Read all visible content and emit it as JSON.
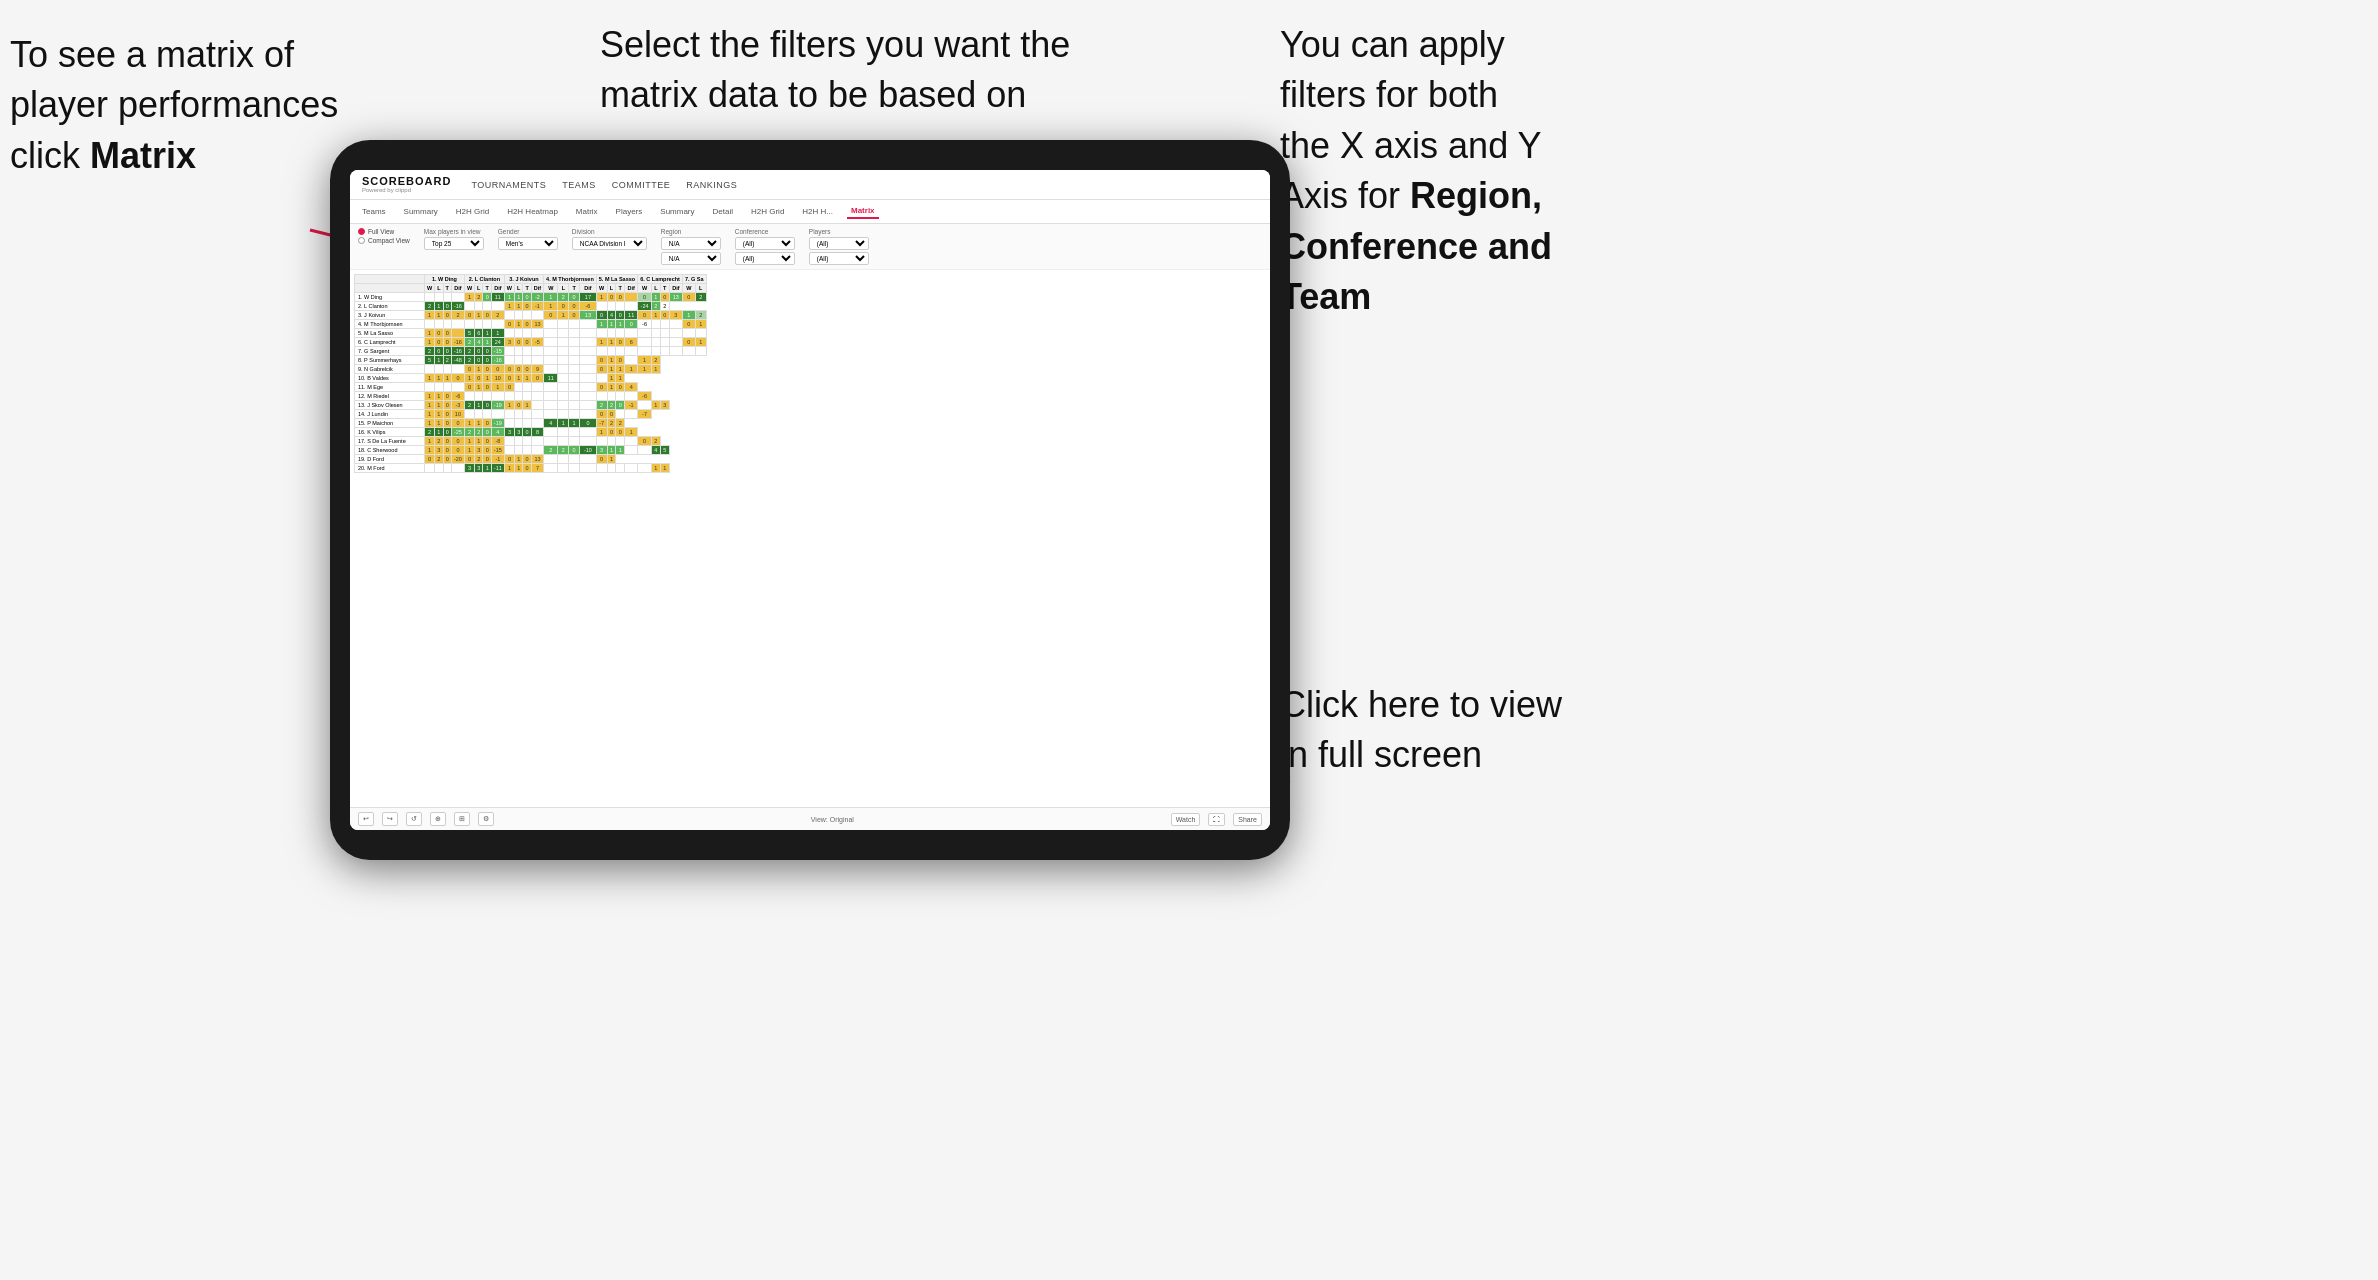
{
  "annotations": {
    "top_left": {
      "line1": "To see a matrix of",
      "line2": "player performances",
      "line3_prefix": "click ",
      "line3_bold": "Matrix"
    },
    "top_center": {
      "text": "Select the filters you want the matrix data to be based on"
    },
    "top_right": {
      "line1": "You  can apply",
      "line2": "filters for both",
      "line3": "the X axis and Y",
      "line4_prefix": "Axis for ",
      "line4_bold": "Region,",
      "line5_bold": "Conference and",
      "line6_bold": "Team"
    },
    "bottom_right": {
      "line1": "Click here to view",
      "line2": "in full screen"
    }
  },
  "app": {
    "brand": "SCOREBOARD",
    "powered_by": "Powered by clippd",
    "nav_items": [
      "TOURNAMENTS",
      "TEAMS",
      "COMMITTEE",
      "RANKINGS"
    ],
    "sub_nav_items": [
      "Teams",
      "Summary",
      "H2H Grid",
      "H2H Heatmap",
      "Matrix",
      "Players",
      "Summary",
      "Detail",
      "H2H Grid",
      "H2H H...",
      "Matrix"
    ],
    "active_tab": "Matrix"
  },
  "filters": {
    "view_full": "Full View",
    "view_compact": "Compact View",
    "max_players_label": "Max players in view",
    "max_players_value": "Top 25",
    "gender_label": "Gender",
    "gender_value": "Men's",
    "division_label": "Division",
    "division_value": "NCAA Division I",
    "region_label": "Region",
    "region_value": "N/A",
    "region_value2": "N/A",
    "conference_label": "Conference",
    "conference_value": "(All)",
    "conference_value2": "(All)",
    "players_label": "Players",
    "players_value": "(All)",
    "players_value2": "(All)"
  },
  "matrix": {
    "col_headers": [
      "1. W Ding",
      "2. L Clanton",
      "3. J Koivun",
      "4. M Thorbjornsen",
      "5. M La Sasso",
      "6. C Lamprecht",
      "7. G Sa"
    ],
    "sub_headers": [
      "W",
      "L",
      "T",
      "Dif"
    ],
    "rows": [
      {
        "name": "1. W Ding",
        "cells": [
          "",
          "",
          "",
          "",
          "1",
          "2",
          "0",
          "11",
          "1",
          "1",
          "0",
          "-2",
          "1",
          "2",
          "0",
          "17",
          "1",
          "0",
          "0",
          "",
          "0",
          "1",
          "0",
          "13",
          "0",
          "2"
        ]
      },
      {
        "name": "2. L Clanton",
        "cells": [
          "2",
          "1",
          "0",
          "-16",
          "",
          "",
          "",
          "",
          "1",
          "1",
          "0",
          "-1",
          "1",
          "0",
          "0",
          "-6",
          "",
          "",
          "",
          "",
          "-24",
          "2",
          "2"
        ]
      },
      {
        "name": "3. J Koivun",
        "cells": [
          "1",
          "1",
          "0",
          "2",
          "0",
          "1",
          "0",
          "2",
          "",
          "",
          "",
          "",
          "0",
          "1",
          "0",
          "13",
          "0",
          "4",
          "0",
          "11",
          "0",
          "1",
          "0",
          "3",
          "1",
          "2"
        ]
      },
      {
        "name": "4. M Thorbjornsen",
        "cells": [
          "",
          "",
          "",
          "",
          "",
          "",
          "",
          "",
          "0",
          "1",
          "0",
          "13",
          "",
          "",
          "",
          "",
          "1",
          "1",
          "1",
          "0",
          "-6",
          "",
          "",
          "",
          "0",
          "1"
        ]
      },
      {
        "name": "5. M La Sasso",
        "cells": [
          "1",
          "0",
          "0",
          "",
          "5",
          "6",
          "1",
          "1",
          "",
          "",
          "",
          "",
          "",
          "",
          "",
          "",
          "",
          "",
          "",
          "",
          "",
          "",
          "",
          "",
          "",
          ""
        ]
      },
      {
        "name": "6. C Lamprecht",
        "cells": [
          "1",
          "0",
          "0",
          "-16",
          "2",
          "4",
          "1",
          "24",
          "3",
          "0",
          "0",
          "-5",
          "",
          "",
          "",
          "",
          "1",
          "1",
          "0",
          "6",
          "",
          "",
          "",
          "",
          "0",
          "1"
        ]
      },
      {
        "name": "7. G Sargent",
        "cells": [
          "2",
          "0",
          "0",
          "-16",
          "2",
          "0",
          "0",
          "-15",
          "",
          "",
          "",
          "",
          "",
          "",
          "",
          "",
          "",
          "",
          "",
          "",
          "",
          "",
          "",
          "",
          "",
          ""
        ]
      },
      {
        "name": "8. P Summerhays",
        "cells": [
          "5",
          "1",
          "2",
          "-48",
          "2",
          "0",
          "0",
          "-16",
          "",
          "",
          "",
          "",
          "",
          "",
          "",
          "",
          "0",
          "1",
          "0",
          "",
          "1",
          "2"
        ]
      },
      {
        "name": "9. N Gabrelcik",
        "cells": [
          "",
          "",
          "",
          "",
          "0",
          "1",
          "0",
          "0",
          "0",
          "0",
          "0",
          "9",
          "",
          "",
          "",
          "",
          "0",
          "1",
          "1",
          "1",
          "1",
          "1"
        ]
      },
      {
        "name": "10. B Valdes",
        "cells": [
          "1",
          "1",
          "1",
          "0",
          "1",
          "0",
          "1",
          "10",
          "0",
          "1",
          "1",
          "0",
          "11",
          "",
          "",
          "",
          "",
          "1",
          "1"
        ]
      },
      {
        "name": "11. M Ege",
        "cells": [
          "",
          "",
          "",
          "",
          "0",
          "1",
          "0",
          "1",
          "0",
          "",
          "",
          "",
          "",
          "",
          "",
          "",
          "0",
          "1",
          "0",
          "4"
        ]
      },
      {
        "name": "12. M Riedel",
        "cells": [
          "1",
          "1",
          "0",
          "-6",
          "",
          "",
          "",
          "",
          "",
          "",
          "",
          "",
          "",
          "",
          "",
          "",
          "",
          "",
          "",
          "",
          "-6"
        ]
      },
      {
        "name": "13. J Skov Olesen",
        "cells": [
          "1",
          "1",
          "0",
          "-3",
          "2",
          "1",
          "0",
          "-19",
          "1",
          "0",
          "1",
          "",
          "",
          "",
          "",
          "",
          "2",
          "2",
          "0",
          "-1",
          "",
          "1",
          "3"
        ]
      },
      {
        "name": "14. J Lundin",
        "cells": [
          "1",
          "1",
          "0",
          "10",
          "",
          "",
          "",
          "",
          "",
          "",
          "",
          "",
          "",
          "",
          "",
          "",
          "0",
          "0",
          "",
          "",
          "-7"
        ]
      },
      {
        "name": "15. P Maichon",
        "cells": [
          "1",
          "1",
          "0",
          "0",
          "1",
          "1",
          "0",
          "-19",
          "",
          "",
          "",
          "",
          "4",
          "1",
          "1",
          "0",
          "-7",
          "2",
          "2"
        ]
      },
      {
        "name": "16. K Vilips",
        "cells": [
          "2",
          "1",
          "0",
          "-25",
          "2",
          "2",
          "0",
          "4",
          "3",
          "3",
          "0",
          "8",
          "",
          "",
          "",
          "",
          "1",
          "0",
          "0",
          "1"
        ]
      },
      {
        "name": "17. S De La Fuente",
        "cells": [
          "1",
          "2",
          "0",
          "0",
          "1",
          "1",
          "0",
          "-8",
          "",
          "",
          "",
          "",
          "",
          "",
          "",
          "",
          "",
          "",
          "",
          "",
          "0",
          "2"
        ]
      },
      {
        "name": "18. C Sherwood",
        "cells": [
          "1",
          "3",
          "0",
          "0",
          "1",
          "3",
          "0",
          "-15",
          "",
          "",
          "",
          "",
          "2",
          "2",
          "0",
          "-10",
          "3",
          "1",
          "1",
          "",
          "",
          "4",
          "5"
        ]
      },
      {
        "name": "19. D Ford",
        "cells": [
          "0",
          "2",
          "0",
          "-20",
          "0",
          "2",
          "0",
          "-1",
          "0",
          "1",
          "0",
          "13",
          "",
          "",
          "",
          "",
          "0",
          "1"
        ]
      },
      {
        "name": "20. M Ford",
        "cells": [
          "",
          "",
          "",
          "",
          "3",
          "3",
          "1",
          "-11",
          "1",
          "1",
          "0",
          "7",
          "",
          "",
          "",
          "",
          "",
          "",
          "",
          "",
          "",
          "1",
          "1"
        ]
      }
    ]
  },
  "toolbar": {
    "view_label": "View: Original",
    "watch_label": "Watch",
    "share_label": "Share"
  }
}
